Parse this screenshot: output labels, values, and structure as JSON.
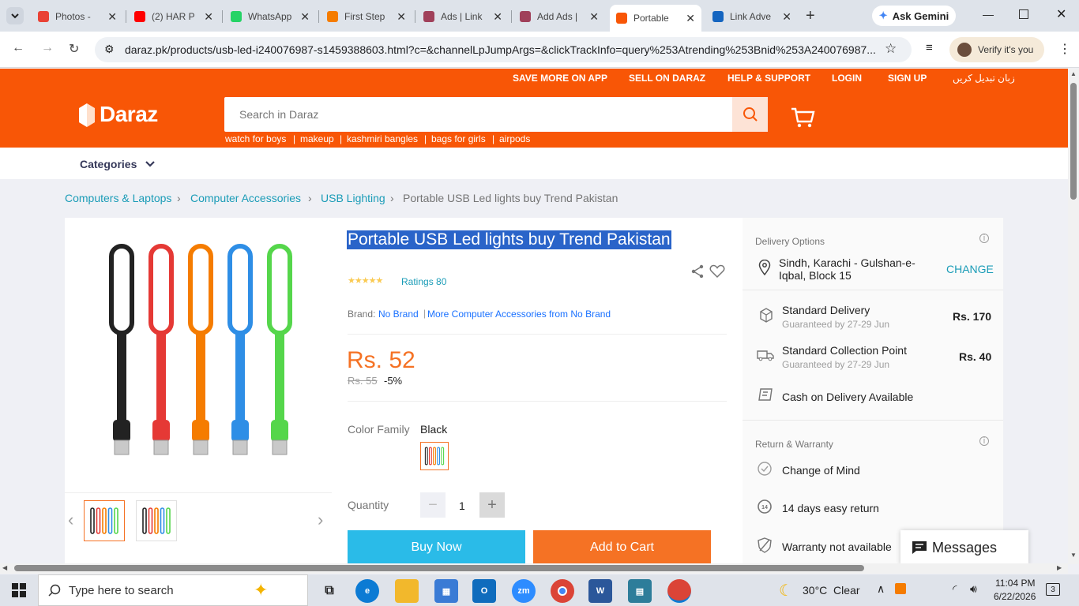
{
  "browser": {
    "tabs": [
      {
        "label": "Photos - ",
        "color": "#e94235",
        "icon": "photos-icon"
      },
      {
        "label": "(2) HAR P",
        "color": "#ff0000",
        "icon": "youtube-icon"
      },
      {
        "label": "WhatsApp",
        "color": "#25d366",
        "icon": "whatsapp-icon"
      },
      {
        "label": "First Step",
        "color": "#f57c00",
        "icon": "firststep-icon"
      },
      {
        "label": "Ads | Link",
        "color": "#a0405a",
        "icon": "gear-icon"
      },
      {
        "label": "Add Ads |",
        "color": "#a0405a",
        "icon": "gear-icon"
      },
      {
        "label": "Portable",
        "color": "#f85606",
        "icon": "daraz-icon"
      },
      {
        "label": "Link Adve",
        "color": "#1565c0",
        "icon": "info-icon"
      }
    ],
    "ask_gemini": "Ask Gemini",
    "url": "daraz.pk/products/usb-led-i240076987-s1459388603.html?c=&channelLpJumpArgs=&clickTrackInfo=query%253Atrending%253Bnid%253A240076987...",
    "verify": "Verify it's you"
  },
  "header": {
    "links": [
      "SAVE MORE ON APP",
      "SELL ON DARAZ",
      "HELP & SUPPORT",
      "LOGIN",
      "SIGN UP",
      "زبان تبدیل کریں"
    ],
    "logo": "Daraz",
    "search_placeholder": "Search in Daraz",
    "keywords": [
      "watch for boys",
      "makeup",
      "kashmiri bangles",
      "bags for girls",
      "airpods"
    ],
    "categories": "Categories"
  },
  "breadcrumb": [
    "Computers & Laptops",
    "Computer Accessories",
    "USB Lighting",
    "Portable USB Led lights buy Trend Pakistan"
  ],
  "product": {
    "title": "Portable USB Led lights buy Trend Pakistan",
    "rating_stars": 4.5,
    "ratings": "Ratings 80",
    "brand_label": "Brand:",
    "brand": "No Brand",
    "more_from": "More Computer Accessories from No Brand",
    "price": "Rs. 52",
    "old_price": "Rs. 55",
    "discount": "-5%",
    "color_label": "Color Family",
    "color_value": "Black",
    "qty_label": "Quantity",
    "qty": "1",
    "buy_now": "Buy Now",
    "add_to_cart": "Add to Cart",
    "led_colors": [
      "#222222",
      "#e53935",
      "#f57c00",
      "#2e8ee6",
      "#55d64b"
    ]
  },
  "delivery": {
    "title": "Delivery Options",
    "address": "Sindh, Karachi - Gulshan-e-Iqbal, Block 15",
    "change": "CHANGE",
    "options": [
      {
        "name": "Standard Delivery",
        "sub": "Guaranteed by 27-29 Jun",
        "price": "Rs. 170"
      },
      {
        "name": "Standard Collection Point",
        "sub": "Guaranteed by 27-29 Jun",
        "price": "Rs. 40"
      }
    ],
    "cod": "Cash on Delivery Available",
    "return_title": "Return & Warranty",
    "returns": [
      "Change of Mind",
      "14 days easy return",
      "Warranty not available"
    ]
  },
  "messages": "Messages",
  "taskbar": {
    "search": "Type here to search",
    "weather": "30°C  Clear",
    "time": "11:04 PM",
    "date": "6/22/2026",
    "notif": "3"
  }
}
